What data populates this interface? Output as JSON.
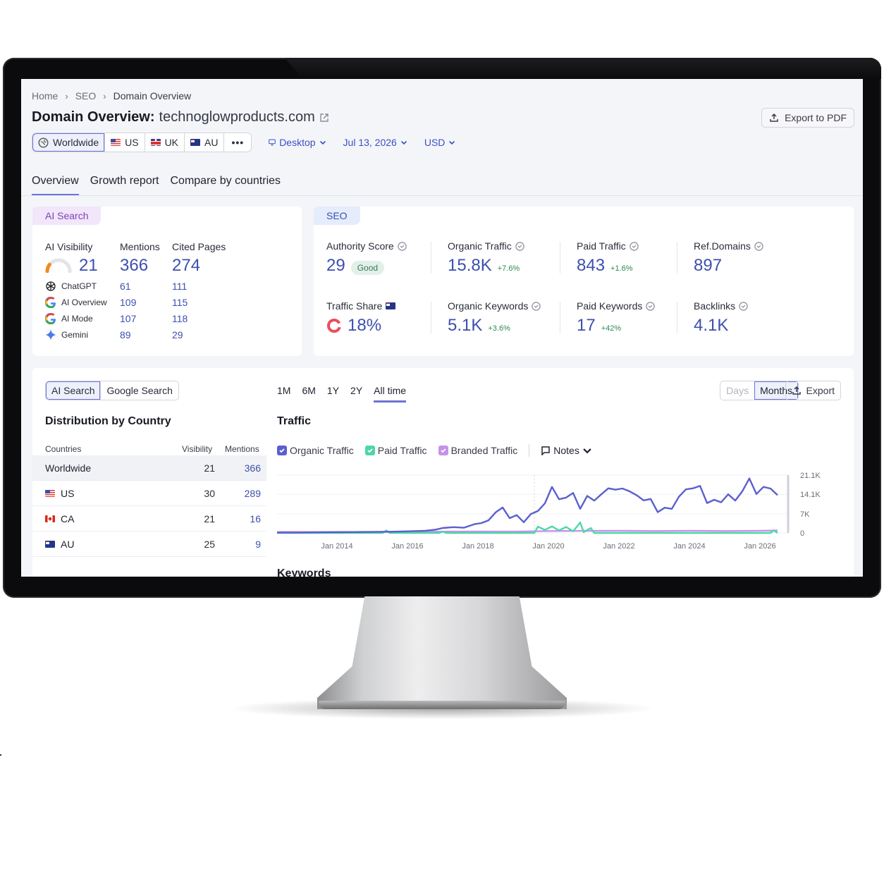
{
  "breadcrumb": [
    "Home",
    "SEO",
    "Domain Overview"
  ],
  "title": {
    "prefix": "Domain Overview:",
    "domain": "technoglowproducts.com"
  },
  "export_pdf_label": "Export to PDF",
  "databases": [
    {
      "label": "Worldwide",
      "icon": "globe-icon",
      "active": true
    },
    {
      "label": "US",
      "icon": "flag-us-icon"
    },
    {
      "label": "UK",
      "icon": "flag-uk-icon"
    },
    {
      "label": "AU",
      "icon": "flag-au-icon"
    }
  ],
  "more_label": "•••",
  "device": "Desktop",
  "date": "Jul 13, 2026",
  "currency": "USD",
  "tabs": [
    "Overview",
    "Growth report",
    "Compare by countries"
  ],
  "ai_search": {
    "pill": "AI Search",
    "headers": {
      "visibility": "AI Visibility",
      "mentions": "Mentions",
      "cited": "Cited Pages"
    },
    "visibility": "21",
    "mentions": "366",
    "cited": "274",
    "visibility_fraction": 0.21,
    "rows": [
      {
        "name": "ChatGPT",
        "icon": "chatgpt-icon",
        "mentions": "61",
        "cited": "111"
      },
      {
        "name": "AI Overview",
        "icon": "google-icon",
        "mentions": "109",
        "cited": "115"
      },
      {
        "name": "AI Mode",
        "icon": "google-icon",
        "mentions": "107",
        "cited": "118"
      },
      {
        "name": "Gemini",
        "icon": "gemini-icon",
        "mentions": "89",
        "cited": "29"
      }
    ]
  },
  "seo": {
    "pill": "SEO",
    "authority": {
      "label": "Authority Score",
      "value": "29",
      "badge": "Good"
    },
    "organic_traffic": {
      "label": "Organic Traffic",
      "value": "15.8K",
      "delta": "+7.6%"
    },
    "paid_traffic": {
      "label": "Paid Traffic",
      "value": "843",
      "delta": "+1.6%"
    },
    "ref_domains": {
      "label": "Ref.Domains",
      "value": "897"
    },
    "traffic_share": {
      "label": "Traffic Share",
      "value": "18%",
      "fraction": 0.18
    },
    "organic_keywords": {
      "label": "Organic Keywords",
      "value": "5.1K",
      "delta": "+3.6%"
    },
    "paid_keywords": {
      "label": "Paid Keywords",
      "value": "17",
      "delta": "+42%"
    },
    "backlinks": {
      "label": "Backlinks",
      "value": "4.1K"
    }
  },
  "distribution": {
    "toggle": [
      "AI Search",
      "Google Search"
    ],
    "title": "Distribution by Country",
    "headers": {
      "countries": "Countries",
      "visibility": "Visibility",
      "mentions": "Mentions"
    },
    "rows": [
      {
        "country": "Worldwide",
        "flag": "",
        "visibility": "21",
        "mentions": "366"
      },
      {
        "country": "US",
        "flag": "us",
        "visibility": "30",
        "mentions": "289"
      },
      {
        "country": "CA",
        "flag": "ca",
        "visibility": "21",
        "mentions": "16"
      },
      {
        "country": "AU",
        "flag": "au",
        "visibility": "25",
        "mentions": "9"
      }
    ]
  },
  "traffic": {
    "periods": [
      "1M",
      "6M",
      "1Y",
      "2Y",
      "All time"
    ],
    "selected_period": "All time",
    "granularity": [
      "Days",
      "Months"
    ],
    "export_label": "Export",
    "title": "Traffic",
    "legend": [
      {
        "name": "Organic Traffic",
        "color": "#5a5fcf"
      },
      {
        "name": "Paid Traffic",
        "color": "#4fd6a8"
      },
      {
        "name": "Branded Traffic",
        "color": "#c792ea"
      }
    ],
    "notes_label": "Notes",
    "next_section": "Keywords"
  },
  "chart_data": {
    "type": "line",
    "title": "Traffic",
    "x_ticks": [
      "Jan 2014",
      "Jan 2016",
      "Jan 2018",
      "Jan 2020",
      "Jan 2022",
      "Jan 2024",
      "Jan 2026"
    ],
    "y_ticks": [
      "21.1K",
      "14.1K",
      "7K",
      "0"
    ],
    "ylim": [
      0,
      21100
    ],
    "xlim": [
      2012.3,
      2026.8
    ],
    "series": [
      {
        "name": "Organic Traffic",
        "color": "#5a5fcf",
        "points": [
          [
            2012.3,
            100
          ],
          [
            2013.0,
            150
          ],
          [
            2013.5,
            200
          ],
          [
            2014.0,
            250
          ],
          [
            2014.5,
            300
          ],
          [
            2015.0,
            350
          ],
          [
            2015.5,
            450
          ],
          [
            2016.0,
            600
          ],
          [
            2016.5,
            800
          ],
          [
            2016.8,
            1200
          ],
          [
            2017.0,
            1800
          ],
          [
            2017.3,
            2100
          ],
          [
            2017.6,
            1900
          ],
          [
            2017.9,
            3200
          ],
          [
            2018.1,
            3600
          ],
          [
            2018.3,
            4600
          ],
          [
            2018.5,
            7500
          ],
          [
            2018.7,
            9300
          ],
          [
            2018.9,
            5400
          ],
          [
            2019.1,
            6500
          ],
          [
            2019.3,
            3900
          ],
          [
            2019.5,
            6900
          ],
          [
            2019.7,
            8000
          ],
          [
            2019.9,
            10800
          ],
          [
            2020.1,
            16800
          ],
          [
            2020.3,
            12300
          ],
          [
            2020.5,
            12900
          ],
          [
            2020.7,
            14600
          ],
          [
            2020.9,
            8800
          ],
          [
            2021.1,
            13500
          ],
          [
            2021.3,
            11800
          ],
          [
            2021.5,
            14100
          ],
          [
            2021.7,
            16300
          ],
          [
            2021.9,
            15800
          ],
          [
            2022.1,
            16200
          ],
          [
            2022.3,
            15200
          ],
          [
            2022.5,
            13800
          ],
          [
            2022.7,
            11900
          ],
          [
            2022.9,
            12400
          ],
          [
            2023.1,
            7600
          ],
          [
            2023.3,
            9200
          ],
          [
            2023.5,
            8800
          ],
          [
            2023.7,
            13200
          ],
          [
            2023.9,
            15900
          ],
          [
            2024.1,
            16300
          ],
          [
            2024.3,
            17200
          ],
          [
            2024.5,
            10900
          ],
          [
            2024.7,
            12100
          ],
          [
            2024.9,
            11200
          ],
          [
            2025.1,
            14100
          ],
          [
            2025.3,
            11800
          ],
          [
            2025.5,
            15200
          ],
          [
            2025.7,
            19900
          ],
          [
            2025.9,
            14200
          ],
          [
            2026.1,
            16800
          ],
          [
            2026.3,
            16200
          ],
          [
            2026.5,
            13800
          ]
        ]
      },
      {
        "name": "Paid Traffic",
        "color": "#4fd6a8",
        "points": [
          [
            2012.3,
            0
          ],
          [
            2015.3,
            0
          ],
          [
            2015.4,
            900
          ],
          [
            2015.5,
            0
          ],
          [
            2016.9,
            0
          ],
          [
            2017.0,
            500
          ],
          [
            2017.1,
            0
          ],
          [
            2019.6,
            0
          ],
          [
            2019.7,
            2300
          ],
          [
            2019.9,
            1100
          ],
          [
            2020.1,
            2400
          ],
          [
            2020.3,
            900
          ],
          [
            2020.5,
            2200
          ],
          [
            2020.7,
            600
          ],
          [
            2020.9,
            3800
          ],
          [
            2021.0,
            300
          ],
          [
            2021.2,
            1800
          ],
          [
            2021.3,
            0
          ],
          [
            2026.3,
            0
          ],
          [
            2026.4,
            900
          ],
          [
            2026.5,
            0
          ]
        ]
      },
      {
        "name": "Branded Traffic",
        "color": "#c792ea",
        "points": [
          [
            2012.3,
            350
          ],
          [
            2014.0,
            350
          ],
          [
            2016.0,
            400
          ],
          [
            2018.0,
            550
          ],
          [
            2019.0,
            500
          ],
          [
            2020.0,
            700
          ],
          [
            2021.0,
            750
          ],
          [
            2022.0,
            800
          ],
          [
            2023.0,
            700
          ],
          [
            2024.0,
            800
          ],
          [
            2025.0,
            700
          ],
          [
            2026.0,
            800
          ],
          [
            2026.5,
            900
          ]
        ]
      }
    ]
  }
}
